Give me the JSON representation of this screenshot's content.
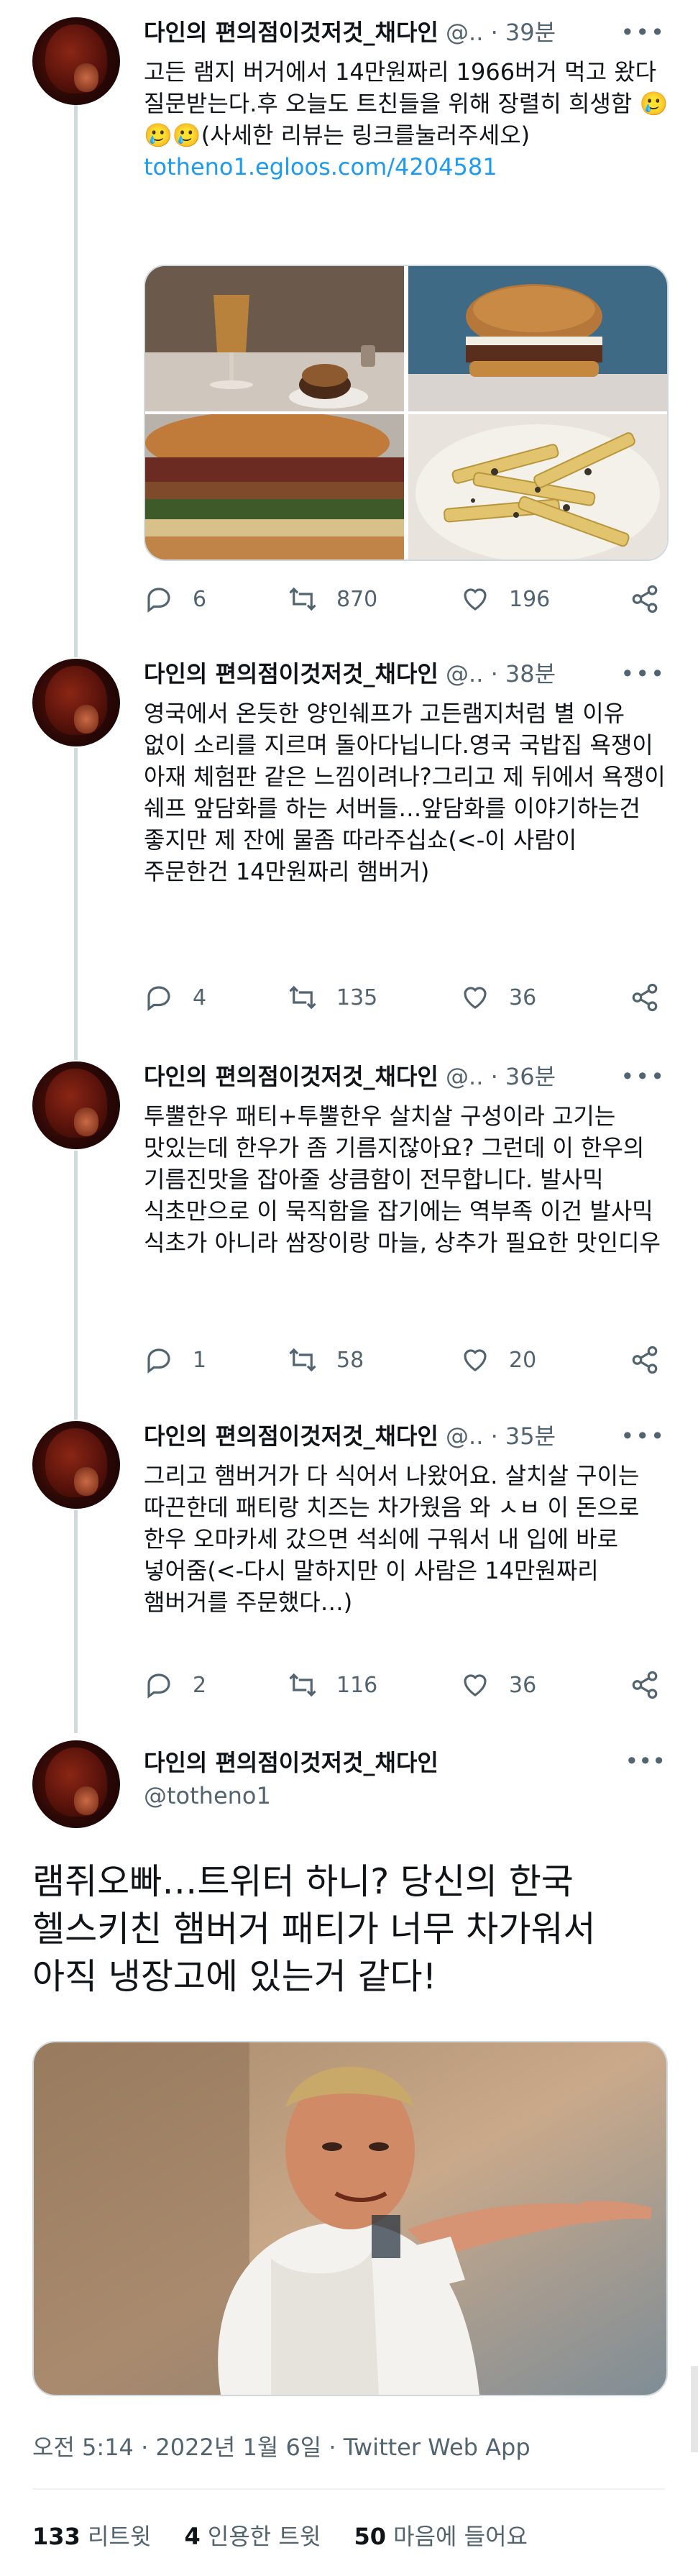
{
  "author": {
    "name": "다인의 편의점이것저것_채다인",
    "handle_short": "@..",
    "handle": "@totheno1"
  },
  "icons": {
    "reply": "reply-bubble-icon",
    "retweet": "retweet-icon",
    "like": "heart-icon",
    "share": "share-icon",
    "more": "more-dots-icon"
  },
  "tweets": [
    {
      "time": "· 39분",
      "text": "고든 램지 버거에서 14만원짜리 1966버거 먹고 왔다 질문받는다.후 오늘도 트친들을 위해 장렬히 희생함 🥲🥲🥲(사세한 리뷰는 링크를눌러주세오)",
      "link": "totheno1.egloos.com/4204581",
      "replies": "6",
      "retweets": "870",
      "likes": "196",
      "media": [
        "beer-glass-and-burger-photo",
        "burger-closeup-photo",
        "burger-cross-section-photo",
        "truffle-fries-photo"
      ]
    },
    {
      "time": "· 38분",
      "text": "영국에서 온듯한 양인쉐프가 고든램지처럼 별 이유 없이 소리를 지르며 돌아다닙니다.영국 국밥집 욕쟁이 아재 체험판 같은 느낌이려나?그리고 제 뒤에서 욕쟁이 쉐프 앞담화를 하는 서버들…앞담화를 이야기하는건 좋지만 제 잔에 물좀 따라주십쇼(<-이 사람이 주문한건 14만원짜리 햄버거)",
      "replies": "4",
      "retweets": "135",
      "likes": "36"
    },
    {
      "time": "· 36분",
      "text": "투뿔한우 패티+투뿔한우 살치살 구성이라 고기는 맛있는데 한우가 좀 기름지잖아요? 그런데 이 한우의 기름진맛을 잡아줄 상큼함이 전무합니다. 발사믹 식초만으로 이 묵직함을 잡기에는 역부족 이건 발사믹 식초가 아니라 쌈장이랑 마늘, 상추가 필요한 맛인디우",
      "replies": "1",
      "retweets": "58",
      "likes": "20"
    },
    {
      "time": "· 35분",
      "text": "그리고 햄버거가 다 식어서 나왔어요. 살치살 구이는 따끈한데 패티랑 치즈는 차가웠음 와 ㅅㅂ 이 돈으로 한우 오마카세 갔으면 석쇠에 구워서 내 입에 바로 넣어줌(<-다시 말하지만 이 사람은 14만원짜리 햄버거를 주문했다…)",
      "replies": "2",
      "retweets": "116",
      "likes": "36"
    }
  ],
  "main_tweet": {
    "text": "램쥐오빠…트위터 하니? 당신의 한국 헬스키친 햄버거 패티가 너무 차가워서 아직 냉장고에 있는거 같다!",
    "image": "pointing-chef-photo",
    "meta": "오전 5:14 · 2022년 1월 6일 · Twitter Web App",
    "stats": {
      "retweets_num": "133",
      "retweets_label": "리트윗",
      "quotes_num": "4",
      "quotes_label": "인용한 트윗",
      "likes_num": "50",
      "likes_label": "마음에 들어요"
    }
  }
}
